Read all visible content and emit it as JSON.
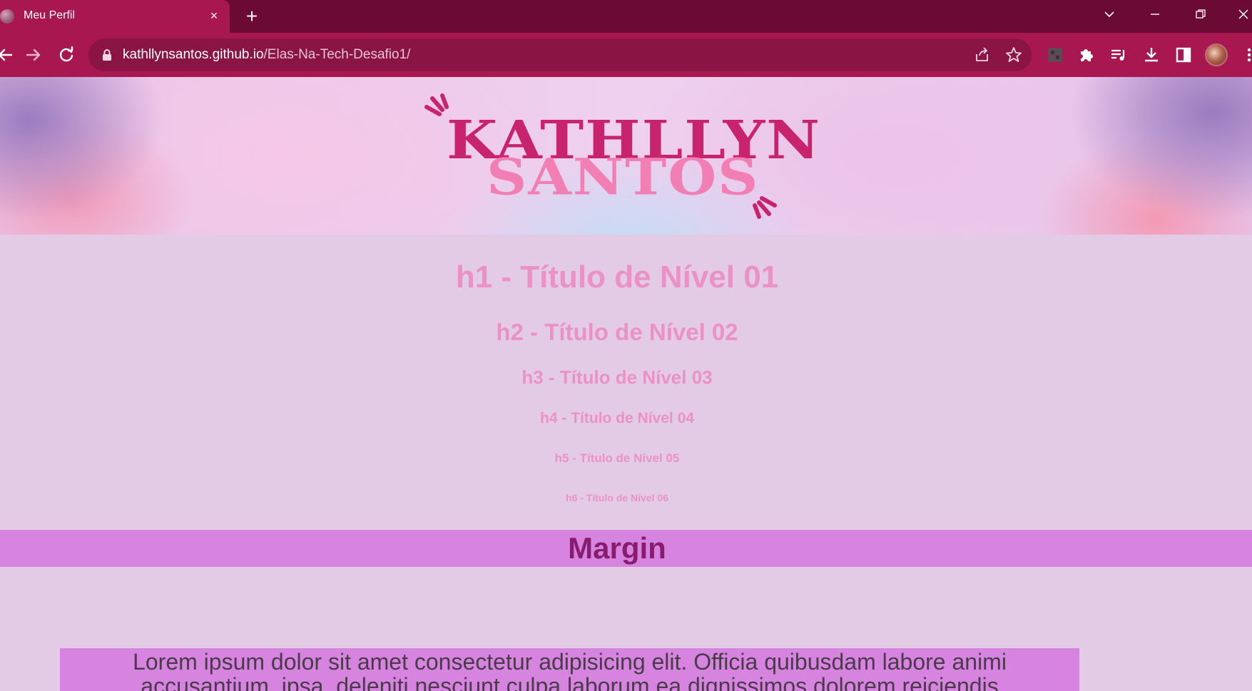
{
  "browser": {
    "tab": {
      "title": "Meu Perfil",
      "close_glyph": "×"
    },
    "new_tab_glyph": "+",
    "window_controls": {
      "tab_search": "⌄",
      "minimize": "—",
      "restore": "❐",
      "close": "✕"
    },
    "address_bar": {
      "host": "kathllynsantos.github.io",
      "path": "/Elas-Na-Tech-Desafio1/"
    },
    "icons": [
      "back-icon",
      "forward-icon",
      "reload-icon",
      "lock-icon",
      "share-icon",
      "bookmark-star-icon",
      "extension-tile-icon",
      "extensions-puzzle-icon",
      "media-playlist-icon",
      "download-icon",
      "side-panel-icon",
      "profile-avatar-icon",
      "more-menu-icon"
    ],
    "colors": {
      "tabstrip": "#6b0a35",
      "toolbar": "#a8174f",
      "omnibox": "#8a1545"
    }
  },
  "page": {
    "logo": {
      "line1": "KATHLLYN",
      "line2": "SANTOS"
    },
    "headings": {
      "h1": "h1 - Título de Nível 01",
      "h2": "h2 - Título de Nível 02",
      "h3": "h3 - Título de Nível 03",
      "h4": "h4 - Título de Nível 04",
      "h5": "h5 - Título de Nível 05",
      "h6": "h6 - Título de Nível 06"
    },
    "margin_title": "Margin",
    "lorem": "Lorem ipsum dolor sit amet consectetur adipisicing elit. Officia quibusdam labore animi accusantium, ipsa, deleniti nesciunt culpa laborum ea dignissimos dolorem reiciendis",
    "colors": {
      "background": "#e3cbe6",
      "heading": "#eb91c7",
      "margin_bar": "#d684e0",
      "margin_text": "#8a1c70"
    }
  }
}
